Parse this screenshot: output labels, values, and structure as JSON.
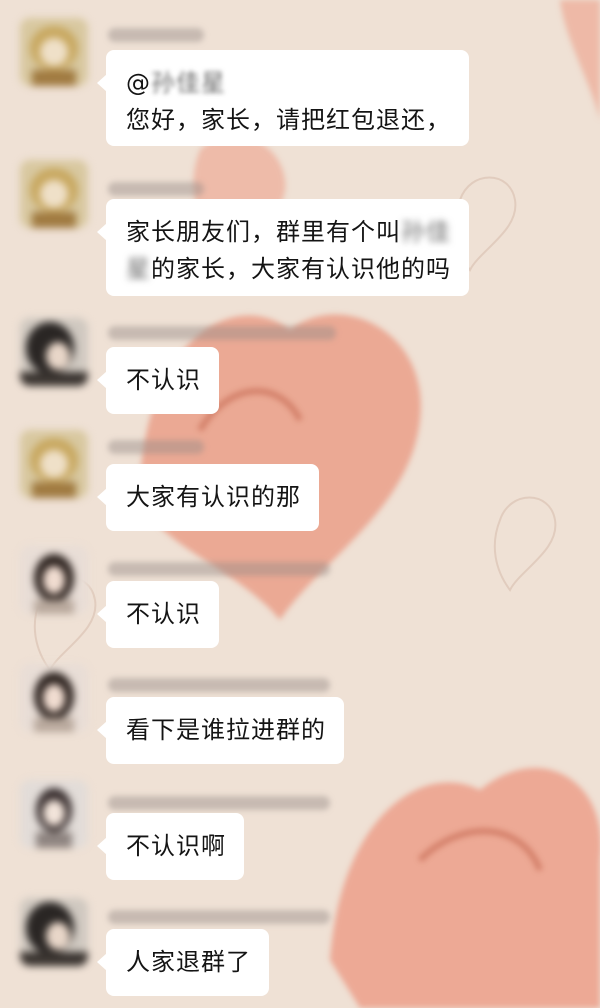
{
  "messages": [
    {
      "sender": "孙佳星家长",
      "avatar": "blonde-avatar-icon",
      "lines": [
        {
          "parts": [
            {
              "text": "@"
            },
            {
              "text": "孙佳星",
              "blur": true
            }
          ]
        },
        {
          "parts": [
            {
              "text": "您好，家长，请把红包退还，"
            }
          ]
        }
      ]
    },
    {
      "sender": "孙佳星家长",
      "avatar": "blonde-avatar-icon",
      "lines": [
        {
          "parts": [
            {
              "text": "家长朋友们，群里有个叫"
            },
            {
              "text": "孙佳",
              "blur": true
            }
          ]
        },
        {
          "parts": [
            {
              "text": "星",
              "blur": true
            },
            {
              "text": "的家长，大家有认识他的吗"
            }
          ]
        }
      ]
    },
    {
      "sender": "家长",
      "avatar": "dark-hair-avatar-icon",
      "lines": [
        {
          "parts": [
            {
              "text": "不认识"
            }
          ]
        }
      ]
    },
    {
      "sender": "孙佳星家长",
      "avatar": "blonde-avatar-icon",
      "lines": [
        {
          "parts": [
            {
              "text": "大家有认识的那"
            }
          ]
        }
      ]
    },
    {
      "sender": "家长",
      "avatar": "girl-avatar-icon",
      "lines": [
        {
          "parts": [
            {
              "text": "不认识"
            }
          ]
        }
      ]
    },
    {
      "sender": "家长",
      "avatar": "girl-avatar-icon",
      "lines": [
        {
          "parts": [
            {
              "text": "看下是谁拉进群的"
            }
          ]
        }
      ]
    },
    {
      "sender": "家长",
      "avatar": "woman-avatar-icon",
      "lines": [
        {
          "parts": [
            {
              "text": "不认识啊"
            }
          ]
        }
      ]
    },
    {
      "sender": "家长",
      "avatar": "dark-hair-avatar-icon",
      "lines": [
        {
          "parts": [
            {
              "text": "人家退群了"
            }
          ]
        }
      ]
    }
  ],
  "colors": {
    "background": "#efe1d5",
    "heart": "#e9a08a",
    "bubble": "#ffffff",
    "text": "#141414"
  }
}
